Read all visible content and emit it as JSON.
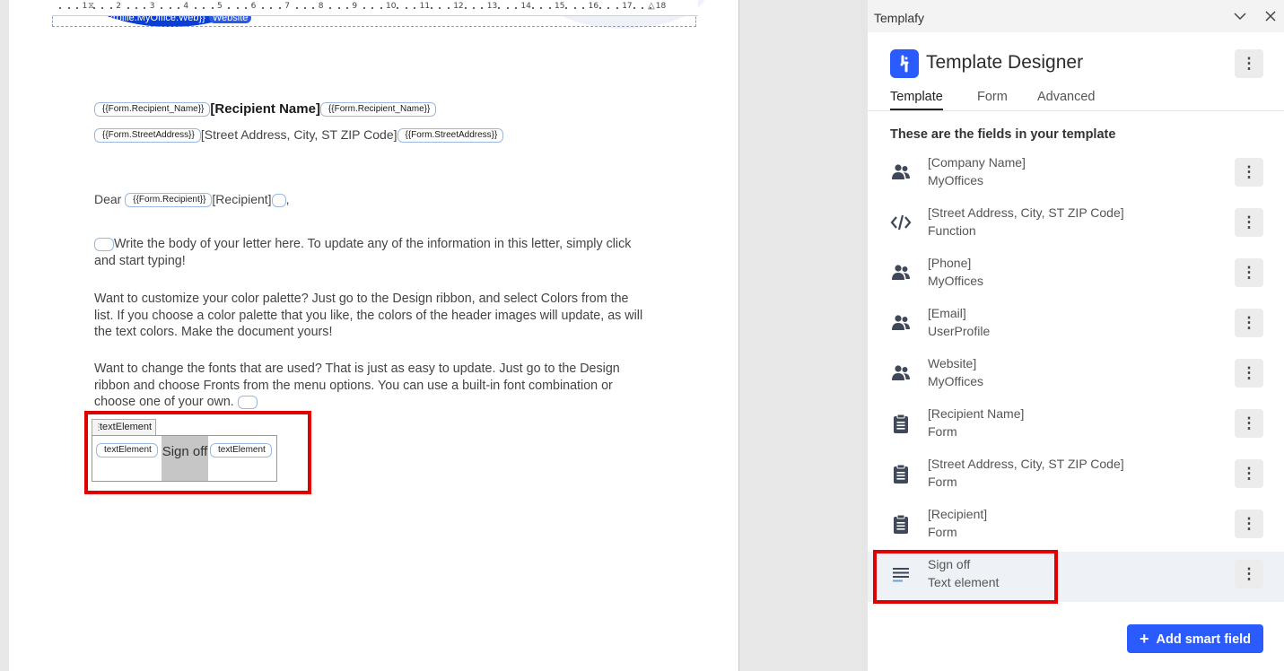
{
  "document": {
    "header": {
      "field_tag": "{{UserProfile.MyOffice.Web}}",
      "field_value": "Website"
    },
    "ruler_numbers": [
      "1",
      "2",
      "3",
      "4",
      "5",
      "6",
      "7",
      "8",
      "9",
      "10",
      "11",
      "12",
      "13",
      "14",
      "15",
      "16",
      "17",
      "18"
    ],
    "recipient_name_line": {
      "tag_open": "{{Form.Recipient_Name}}",
      "value": "[Recipient Name]",
      "tag_close": "{{Form.Recipient_Name}}"
    },
    "street_line": {
      "tag_open": "{{Form.StreetAddress}}",
      "value": "[Street Address, City, ST ZIP Code]",
      "tag_close": "{{Form.StreetAddress}}"
    },
    "dear_line": {
      "prefix": "Dear",
      "tag_open": "{{Form.Recipient}}",
      "value": "[Recipient]",
      "suffix": ","
    },
    "paragraphs": [
      "Write the body of your letter here.  To update any of the information in this letter, simply click and start typing!",
      "Want to customize your color palette?  Just go to the Design ribbon, and select Colors from the list.  If you choose a color palette that you like, the colors of the header images will update, as will the text colors.  Make the document yours!",
      "Want to change the fonts that are used?  That is just as easy to update.  Just go to the Design ribbon and choose Fronts from the menu options.  You can use a built-in font combination or choose one of your own."
    ],
    "text_element": {
      "label": "textElement",
      "tag_open": "textElement",
      "value": "Sign off",
      "tag_close": "textElement"
    }
  },
  "panel": {
    "window_title": "Templafy",
    "app_name": "Template Designer",
    "tabs": [
      {
        "label": "Template",
        "active": true
      },
      {
        "label": "Form",
        "active": false
      },
      {
        "label": "Advanced",
        "active": false
      }
    ],
    "fields_heading": "These are the fields in your template",
    "fields": [
      {
        "name": "[Company Name]",
        "type": "MyOffices",
        "icon": "people-icon"
      },
      {
        "name": "[Street Address, City, ST ZIP Code]",
        "type": "Function",
        "icon": "code-icon"
      },
      {
        "name": "[Phone]",
        "type": "MyOffices",
        "icon": "people-icon"
      },
      {
        "name": "[Email]",
        "type": "UserProfile",
        "icon": "people-icon"
      },
      {
        "name": "Website]",
        "type": "MyOffices",
        "icon": "people-icon"
      },
      {
        "name": "[Recipient Name]",
        "type": "Form",
        "icon": "clipboard-icon"
      },
      {
        "name": "[Street Address, City, ST ZIP Code]",
        "type": "Form",
        "icon": "clipboard-icon"
      },
      {
        "name": "[Recipient]",
        "type": "Form",
        "icon": "clipboard-icon"
      },
      {
        "name": "Sign off",
        "type": "Text element",
        "icon": "text-lines-icon",
        "selected": true
      }
    ],
    "add_button_label": "Add smart field",
    "colors": {
      "brand": "#2a5bff",
      "highlight": "#e00000",
      "icon": "#3f4858"
    }
  }
}
